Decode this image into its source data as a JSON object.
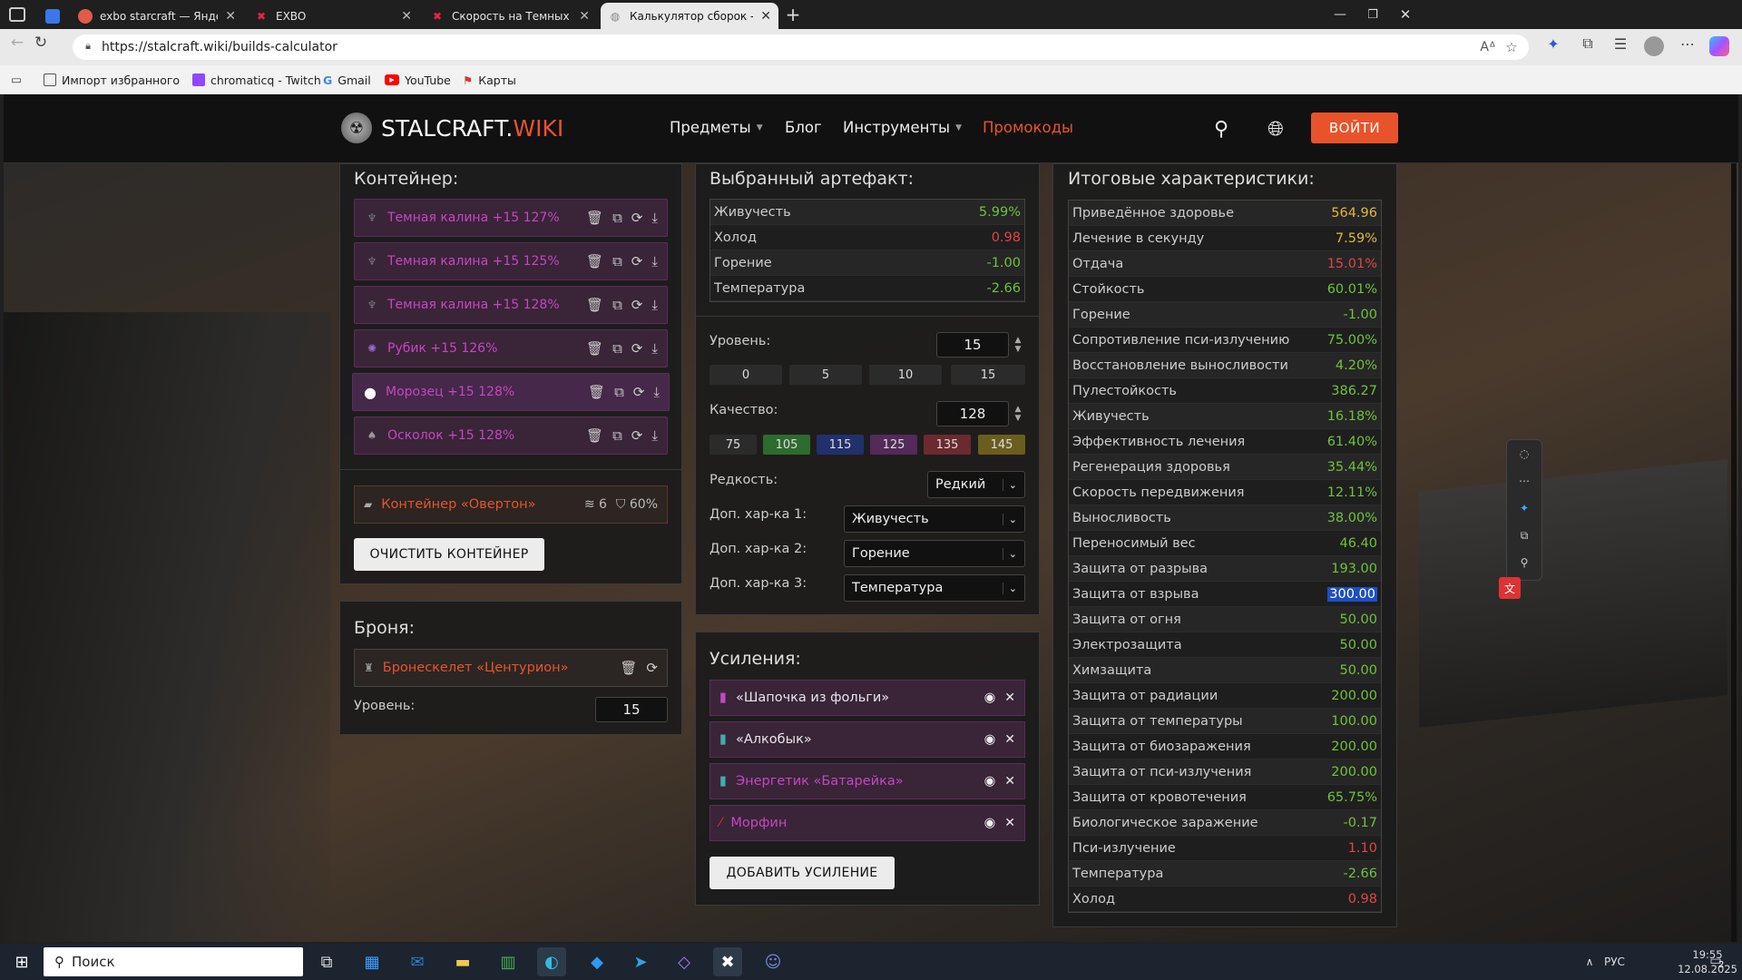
{
  "browser": {
    "tabs": [
      {
        "title": "",
        "active": false
      },
      {
        "title": "exbo starcraft — Яндекс: нашлос",
        "active": false
      },
      {
        "title": "EXBO",
        "active": false
      },
      {
        "title": "Скорость на Темных Калинах - E",
        "active": false
      },
      {
        "title": "Калькулятор сборок - STALCRAF",
        "active": true
      }
    ],
    "url": "https://stalcraft.wiki/builds-calculator",
    "bookmarks": [
      "Импорт избранного",
      "chromaticq - Twitch",
      "Gmail",
      "YouTube",
      "Карты"
    ]
  },
  "site": {
    "logo_main": "STALCRAFT.",
    "logo_accent": "WIKI",
    "nav": [
      {
        "label": "Предметы",
        "dropdown": true
      },
      {
        "label": "Блог",
        "dropdown": false
      },
      {
        "label": "Инструменты",
        "dropdown": true
      },
      {
        "label": "Промокоды",
        "dropdown": false
      }
    ],
    "login": "ВОЙТИ",
    "accent": "#e8532b"
  },
  "container": {
    "title": "Контейнер:",
    "items": [
      {
        "name": "Темная калина +15 127%"
      },
      {
        "name": "Темная калина +15 125%"
      },
      {
        "name": "Темная калина +15 128%"
      },
      {
        "name": "Рубик +15 126%"
      },
      {
        "name": "Морозец +15 128%"
      },
      {
        "name": "Осколок +15 128%"
      }
    ],
    "container_name": "Контейнер «Овертон»",
    "slots": "6",
    "protection": "60%",
    "clear_button": "ОЧИСТИТЬ КОНТЕЙНЕР"
  },
  "armor": {
    "title": "Броня:",
    "name": "Бронескелет «Центурион»",
    "level_label": "Уровень:",
    "level": "15"
  },
  "artifact": {
    "title": "Выбранный артефакт:",
    "stats": [
      {
        "name": "Живучесть",
        "value": "5.99%",
        "color": "#6fc23b"
      },
      {
        "name": "Холод",
        "value": "0.98",
        "color": "#e04545"
      },
      {
        "name": "Горение",
        "value": "-1.00",
        "color": "#6fc23b"
      },
      {
        "name": "Температура",
        "value": "-2.66",
        "color": "#6fc23b"
      }
    ],
    "level_label": "Уровень:",
    "level": "15",
    "level_presets": [
      "0",
      "5",
      "10",
      "15"
    ],
    "quality_label": "Качество:",
    "quality": "128",
    "quality_presets": [
      {
        "label": "75",
        "bg": "#2b2b2b"
      },
      {
        "label": "105",
        "bg": "#2e6b2e"
      },
      {
        "label": "115",
        "bg": "#22306b"
      },
      {
        "label": "125",
        "bg": "#532a5a"
      },
      {
        "label": "135",
        "bg": "#6b2a2e"
      },
      {
        "label": "145",
        "bg": "#6b5d1e"
      }
    ],
    "rarity_label": "Редкость:",
    "rarity": "Редкий",
    "extra1_label": "Доп. хар-ка 1:",
    "extra1": "Живучесть",
    "extra2_label": "Доп. хар-ка 2:",
    "extra2": "Горение",
    "extra3_label": "Доп. хар-ка 3:",
    "extra3": "Температура"
  },
  "boosts": {
    "title": "Усиления:",
    "items": [
      {
        "name": "«Шапочка из фольги»",
        "color": "#e6e6e6"
      },
      {
        "name": "«Алкобык»",
        "color": "#e6e6e6"
      },
      {
        "name": "Энергетик «Батарейка»",
        "color": "#c447c1"
      },
      {
        "name": "Морфин",
        "color": "#c447c1"
      }
    ],
    "add_button": "ДОБАВИТЬ УСИЛЕНИЕ"
  },
  "totals": {
    "title": "Итоговые характеристики:",
    "stats": [
      {
        "name": "Приведённое здоровье",
        "value": "564.96",
        "color": "#e0b83a"
      },
      {
        "name": "Лечение в секунду",
        "value": "7.59%",
        "color": "#e0b83a"
      },
      {
        "name": "Отдача",
        "value": "15.01%",
        "color": "#e04545"
      },
      {
        "name": "Стойкость",
        "value": "60.01%",
        "color": "#6fc23b"
      },
      {
        "name": "Горение",
        "value": "-1.00",
        "color": "#6fc23b"
      },
      {
        "name": "Сопротивление пси-излучению",
        "value": "75.00%",
        "color": "#6fc23b"
      },
      {
        "name": "Восстановление выносливости",
        "value": "4.20%",
        "color": "#6fc23b"
      },
      {
        "name": "Пулестойкость",
        "value": "386.27",
        "color": "#6fc23b"
      },
      {
        "name": "Живучесть",
        "value": "16.18%",
        "color": "#6fc23b"
      },
      {
        "name": "Эффективность лечения",
        "value": "61.40%",
        "color": "#6fc23b"
      },
      {
        "name": "Регенерация здоровья",
        "value": "35.44%",
        "color": "#6fc23b"
      },
      {
        "name": "Скорость передвижения",
        "value": "12.11%",
        "color": "#6fc23b"
      },
      {
        "name": "Выносливость",
        "value": "38.00%",
        "color": "#6fc23b"
      },
      {
        "name": "Переносимый вес",
        "value": "46.40",
        "color": "#6fc23b"
      },
      {
        "name": "Защита от разрыва",
        "value": "193.00",
        "color": "#6fc23b"
      },
      {
        "name": "Защита от взрыва",
        "value": "300.00",
        "color": "#ffffff"
      },
      {
        "name": "Защита от огня",
        "value": "50.00",
        "color": "#6fc23b"
      },
      {
        "name": "Электрозащита",
        "value": "50.00",
        "color": "#6fc23b"
      },
      {
        "name": "Химзащита",
        "value": "50.00",
        "color": "#6fc23b"
      },
      {
        "name": "Защита от радиации",
        "value": "200.00",
        "color": "#6fc23b"
      },
      {
        "name": "Защита от температуры",
        "value": "100.00",
        "color": "#6fc23b"
      },
      {
        "name": "Защита от биозаражения",
        "value": "200.00",
        "color": "#6fc23b"
      },
      {
        "name": "Защита от пси-излучения",
        "value": "200.00",
        "color": "#6fc23b"
      },
      {
        "name": "Защита от кровотечения",
        "value": "65.75%",
        "color": "#6fc23b"
      },
      {
        "name": "Биологическое заражение",
        "value": "-0.17",
        "color": "#6fc23b"
      },
      {
        "name": "Пси-излучение",
        "value": "1.10",
        "color": "#e04545"
      },
      {
        "name": "Температура",
        "value": "-2.66",
        "color": "#6fc23b"
      },
      {
        "name": "Холод",
        "value": "0.98",
        "color": "#e04545"
      }
    ]
  },
  "taskbar": {
    "search": "Поиск",
    "lang": "РУС",
    "time": "19:55",
    "date": "12.08.2025",
    "notifications": "2"
  }
}
